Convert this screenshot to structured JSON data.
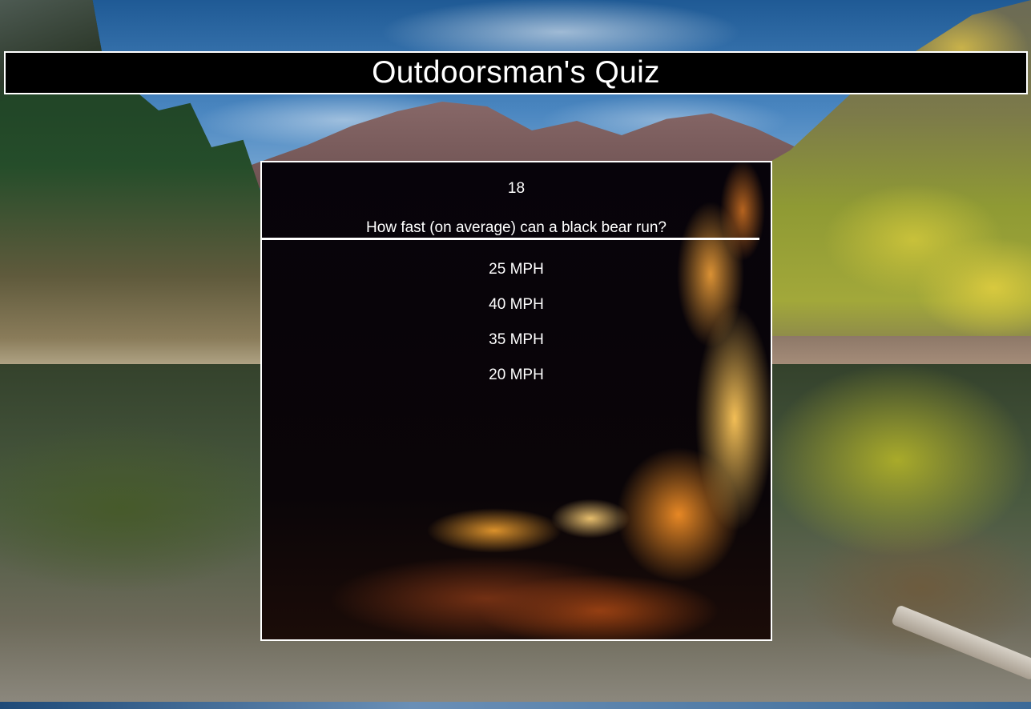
{
  "header": {
    "title": "Outdoorsman's Quiz"
  },
  "quiz": {
    "question_number": "18",
    "question": "How fast (on average) can a black bear run?",
    "answers": [
      "25 MPH",
      "40 MPH",
      "35 MPH",
      "20 MPH"
    ]
  },
  "colors": {
    "banner_bg": "#000000",
    "text": "#ffffff",
    "panel_border": "#ffffff"
  }
}
